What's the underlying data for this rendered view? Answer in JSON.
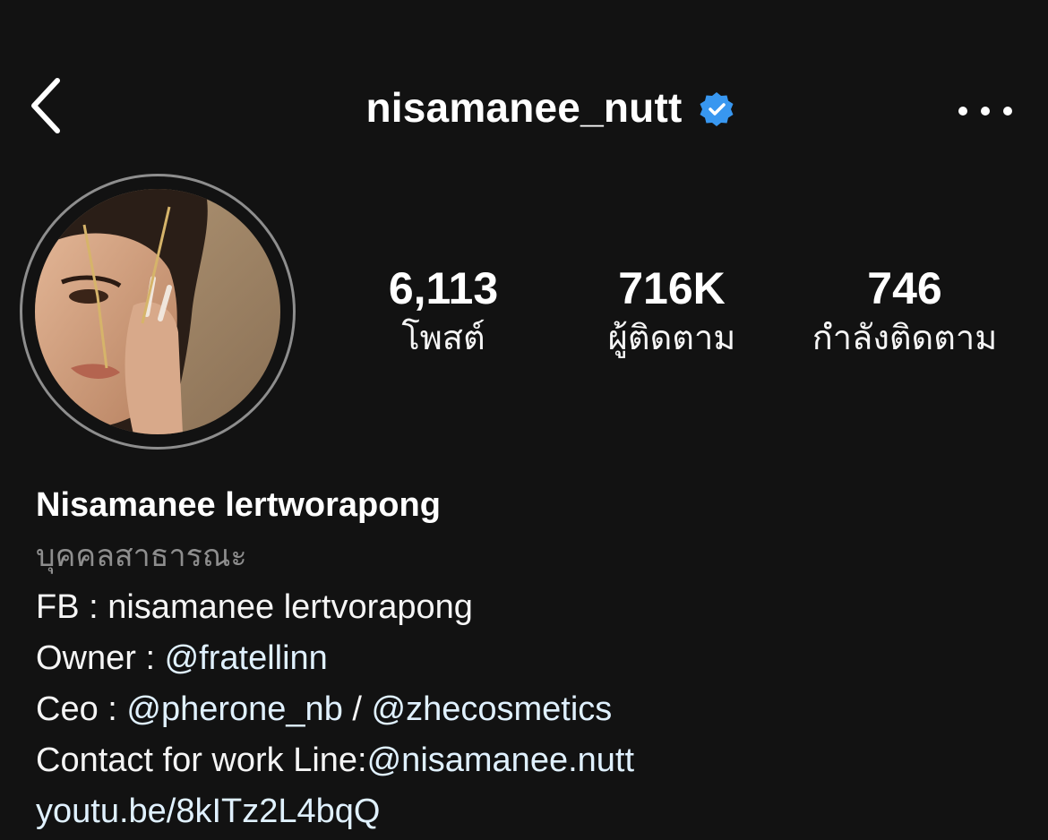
{
  "header": {
    "username": "nisamanee_nutt",
    "verified_icon": "verified-badge-icon",
    "back_icon": "chevron-left-icon",
    "more_icon": "more-horizontal-icon",
    "verified_color": "#3897f0"
  },
  "profile": {
    "avatar_icon": "profile-photo",
    "stats": {
      "posts": {
        "value": "6,113",
        "label": "โพสต์"
      },
      "followers": {
        "value": "716K",
        "label": "ผู้ติดตาม"
      },
      "following": {
        "value": "746",
        "label": "กำลังติดตาม"
      }
    }
  },
  "bio": {
    "name": "Nisamanee lertworapong",
    "category": "บุคคลสาธารณะ",
    "fb_line": "FB : nisamanee lertvorapong",
    "owner_prefix": "Owner : ",
    "owner_mention": "@fratellinn",
    "ceo_prefix": "Ceo : ",
    "ceo_mention_1": "@pherone_nb",
    "ceo_separator": " / ",
    "ceo_mention_2": "@zhecosmetics",
    "contact_prefix": "Contact for work Line:",
    "contact_mention": "@nisamanee.nutt",
    "link": "youtu.be/8kITz2L4bqQ"
  },
  "colors": {
    "background": "#121212",
    "text": "#f5f5f5",
    "muted": "#8e8e8e",
    "link": "#e0f1ff"
  }
}
